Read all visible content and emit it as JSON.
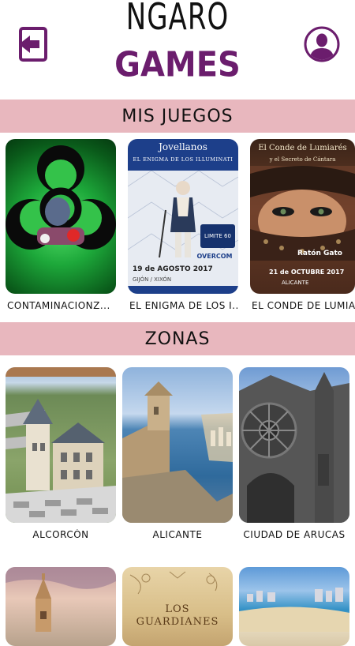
{
  "header": {
    "logo_top": "NGARO",
    "logo_bottom": "GAMES"
  },
  "sections": {
    "games_title": "MIS JUEGOS",
    "zones_title": "ZONAS"
  },
  "games": [
    {
      "label": "CONTAMINACIONZ..."
    },
    {
      "label": "EL ENIGMA DE LOS I...",
      "poster_title": "Jovellanos",
      "poster_subtitle": "EL ENIGMA DE LOS ILLUMINATI",
      "poster_date": "19 de AGOSTO 2017",
      "poster_place": "GIJÓN / XIXÓN",
      "poster_badge": "LIMITE 60",
      "poster_sponsor": "OVERCOM"
    },
    {
      "label": "EL CONDE DE LUMIA...",
      "poster_title": "El Conde de Lumiarés",
      "poster_subtitle": "y el Secreto de Cántara",
      "poster_brand": "Ratón Gato",
      "poster_date": "21 de OCTUBRE 2017",
      "poster_place": "ALICANTE"
    }
  ],
  "zones": [
    {
      "label": "ALCORCÓN"
    },
    {
      "label": "ALICANTE"
    },
    {
      "label": "CIUDAD DE ARUCAS"
    },
    {
      "label": ""
    },
    {
      "label": "",
      "card_text": "LOS GUARDIANES"
    },
    {
      "label": ""
    }
  ],
  "colors": {
    "brand_purple": "#6b1d6d",
    "section_pink": "#e8b7be"
  }
}
